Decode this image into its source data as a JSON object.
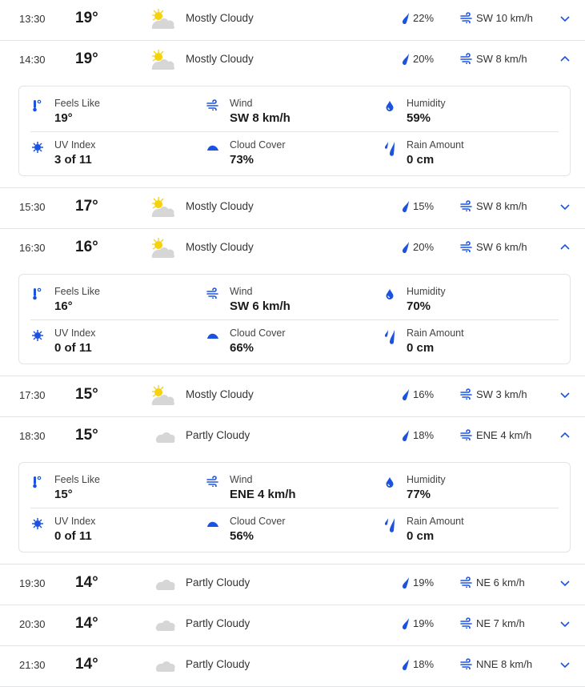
{
  "colors": {
    "accent": "#1b53e0",
    "divider": "#e1e3e6",
    "sun": "#f5d20c",
    "cloud": "#d6d6d6"
  },
  "detail_labels": {
    "feels_like": "Feels Like",
    "wind": "Wind",
    "humidity": "Humidity",
    "uv_index": "UV Index",
    "cloud_cover": "Cloud Cover",
    "rain_amount": "Rain Amount"
  },
  "hours": [
    {
      "time": "13:30",
      "temp": "19°",
      "icon": "mostly-cloudy-day-icon",
      "condition": "Mostly Cloudy",
      "precip": "22%",
      "wind": "SW 10 km/h",
      "expanded": false
    },
    {
      "time": "14:30",
      "temp": "19°",
      "icon": "mostly-cloudy-day-icon",
      "condition": "Mostly Cloudy",
      "precip": "20%",
      "wind": "SW 8 km/h",
      "expanded": true,
      "details": {
        "feels_like": "19°",
        "wind": "SW 8 km/h",
        "humidity": "59%",
        "uv_index": "3 of 11",
        "cloud_cover": "73%",
        "rain_amount": "0 cm"
      }
    },
    {
      "time": "15:30",
      "temp": "17°",
      "icon": "mostly-cloudy-day-icon",
      "condition": "Mostly Cloudy",
      "precip": "15%",
      "wind": "SW 8 km/h",
      "expanded": false
    },
    {
      "time": "16:30",
      "temp": "16°",
      "icon": "mostly-cloudy-day-icon",
      "condition": "Mostly Cloudy",
      "precip": "20%",
      "wind": "SW 6 km/h",
      "expanded": true,
      "details": {
        "feels_like": "16°",
        "wind": "SW 6 km/h",
        "humidity": "70%",
        "uv_index": "0 of 11",
        "cloud_cover": "66%",
        "rain_amount": "0 cm"
      }
    },
    {
      "time": "17:30",
      "temp": "15°",
      "icon": "mostly-cloudy-day-icon",
      "condition": "Mostly Cloudy",
      "precip": "16%",
      "wind": "SW 3 km/h",
      "expanded": false
    },
    {
      "time": "18:30",
      "temp": "15°",
      "icon": "partly-cloudy-night-icon",
      "condition": "Partly Cloudy",
      "precip": "18%",
      "wind": "ENE 4 km/h",
      "expanded": true,
      "details": {
        "feels_like": "15°",
        "wind": "ENE 4 km/h",
        "humidity": "77%",
        "uv_index": "0 of 11",
        "cloud_cover": "56%",
        "rain_amount": "0 cm"
      }
    },
    {
      "time": "19:30",
      "temp": "14°",
      "icon": "partly-cloudy-night-icon",
      "condition": "Partly Cloudy",
      "precip": "19%",
      "wind": "NE 6 km/h",
      "expanded": false
    },
    {
      "time": "20:30",
      "temp": "14°",
      "icon": "partly-cloudy-night-icon",
      "condition": "Partly Cloudy",
      "precip": "19%",
      "wind": "NE 7 km/h",
      "expanded": false
    },
    {
      "time": "21:30",
      "temp": "14°",
      "icon": "partly-cloudy-night-icon",
      "condition": "Partly Cloudy",
      "precip": "18%",
      "wind": "NNE 8 km/h",
      "expanded": false
    }
  ]
}
